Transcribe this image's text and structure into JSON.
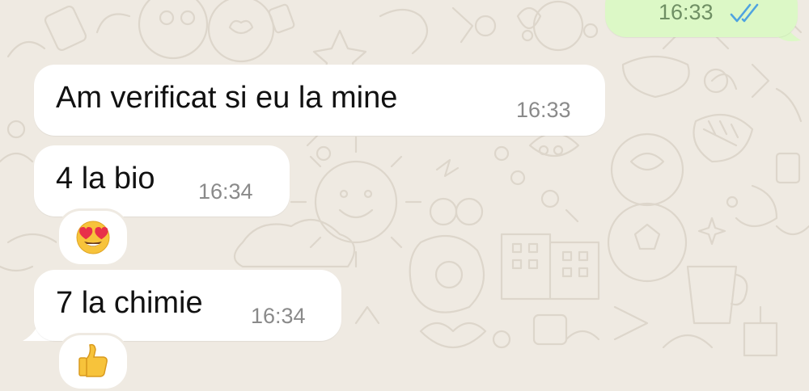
{
  "messages": [
    {
      "direction": "outgoing",
      "text": "",
      "time": "16:33",
      "status": "read",
      "status_icon": "double-check-icon"
    },
    {
      "direction": "incoming",
      "text": "Am verificat si eu la mine",
      "time": "16:33"
    },
    {
      "direction": "incoming",
      "text": "4 la bio",
      "time": "16:34",
      "reaction": "heart-eyes-emoji"
    },
    {
      "direction": "incoming",
      "text": "7 la chimie",
      "time": "16:34",
      "reaction": "thumbs-up-emoji"
    }
  ],
  "colors": {
    "wallpaper": "#efeae2",
    "incoming_bubble": "#ffffff",
    "outgoing_bubble": "#dcf8c6",
    "read_tick": "#4fa3e0",
    "time_text": "#8a8a8a"
  }
}
